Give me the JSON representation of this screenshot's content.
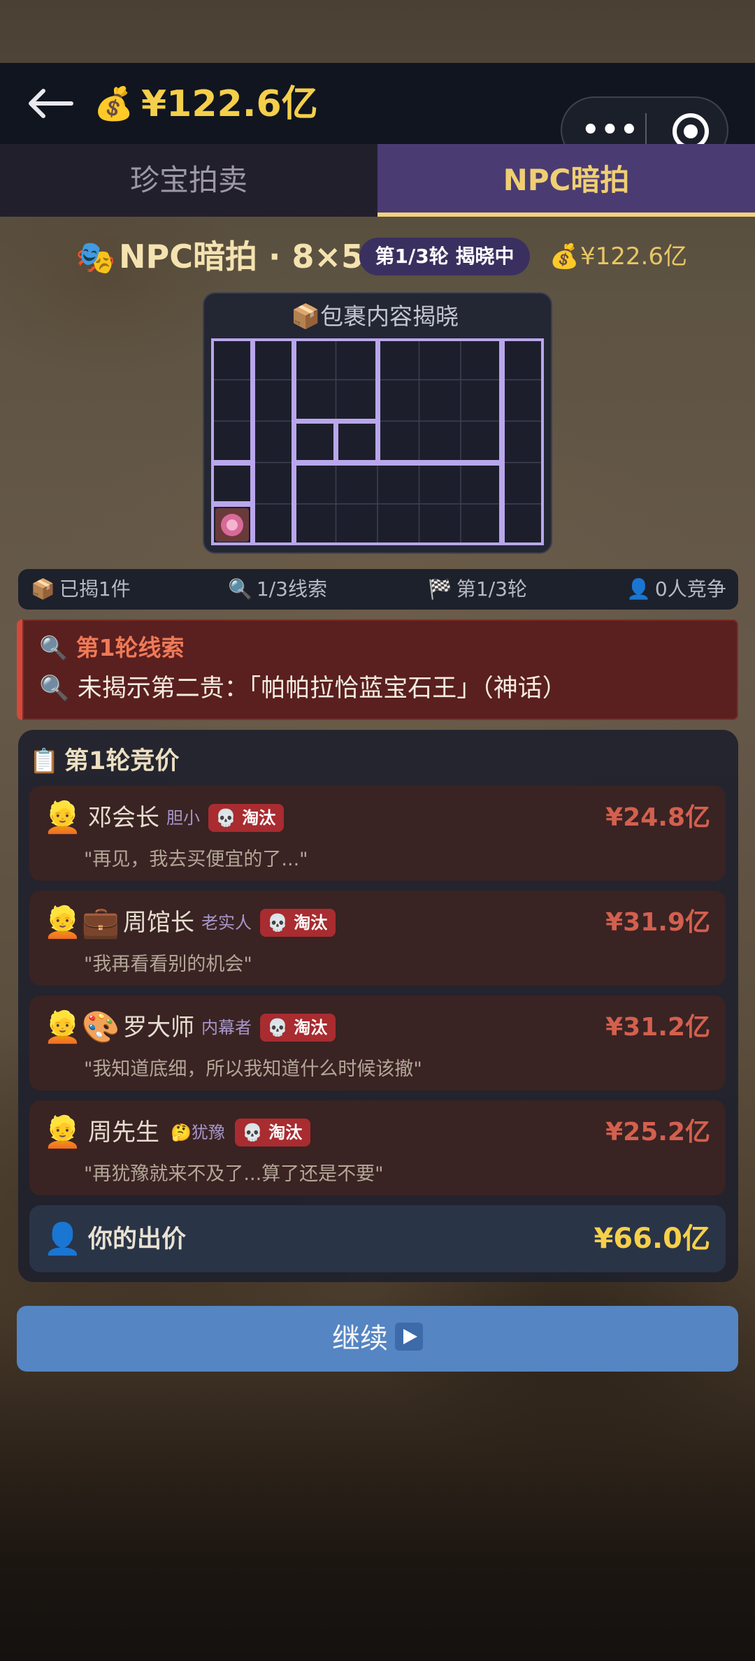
{
  "header": {
    "back_icon": "back-arrow-icon",
    "money_icon": "money-bag-icon",
    "balance": "¥122.6亿",
    "more_icon": "more-dots-icon",
    "close_icon": "target-close-icon"
  },
  "tabs": [
    {
      "label": "珍宝拍卖",
      "active": false
    },
    {
      "label": "NPC暗拍",
      "active": true
    }
  ],
  "title": {
    "icon": "theater-masks-icon",
    "text": "NPC暗拍 · 8×5",
    "round_status": "第1/3轮 揭晓中",
    "balance": "¥122.6亿"
  },
  "parcel": {
    "icon": "package-icon",
    "title": "包裹内容揭晓",
    "columns": 8,
    "rows": 5,
    "revealed_item_icon": "gem-item-icon"
  },
  "stats": [
    {
      "icon": "package-icon",
      "text": "已揭1件"
    },
    {
      "icon": "magnifier-icon",
      "text": "1/3线索"
    },
    {
      "icon": "checkered-flag-icon",
      "text": "第1/3轮"
    },
    {
      "icon": "person-icon",
      "text": "0人竞争"
    }
  ],
  "clue": {
    "title": "🔍 第1轮线索",
    "text": "🔍 未揭示第二贵：「帕帕拉恰蓝宝石王」（神话）"
  },
  "bidding": {
    "title": "第1轮竞价",
    "eliminated_label": "淘汰",
    "npcs": [
      {
        "avatar": "👱",
        "name": "邓会长",
        "trait": "胆小",
        "price": "¥24.8亿",
        "quote": "\"再见，我去买便宜的了...\""
      },
      {
        "avatar": "👱💼",
        "name": "周馆长",
        "trait": "老实人",
        "price": "¥31.9亿",
        "quote": "\"我再看看别的机会\""
      },
      {
        "avatar": "👱🎨",
        "name": "罗大师",
        "trait": "内幕者",
        "price": "¥31.2亿",
        "quote": "\"我知道底细，所以我知道什么时候该撤\""
      },
      {
        "avatar": "👱",
        "name": "周先生",
        "trait": "🤔犹豫",
        "price": "¥25.2亿",
        "quote": "\"再犹豫就来不及了...算了还是不要\""
      }
    ],
    "your_bid_label": "你的出价",
    "your_bid_price": "¥66.0亿"
  },
  "continue_button": {
    "label": "继续"
  },
  "colors": {
    "accent_gold": "#f4cf4a",
    "tab_active_bg": "#4a3c72",
    "eliminated_red": "#a82c30",
    "price_red": "#d3604e",
    "continue_blue": "#5585c2"
  }
}
